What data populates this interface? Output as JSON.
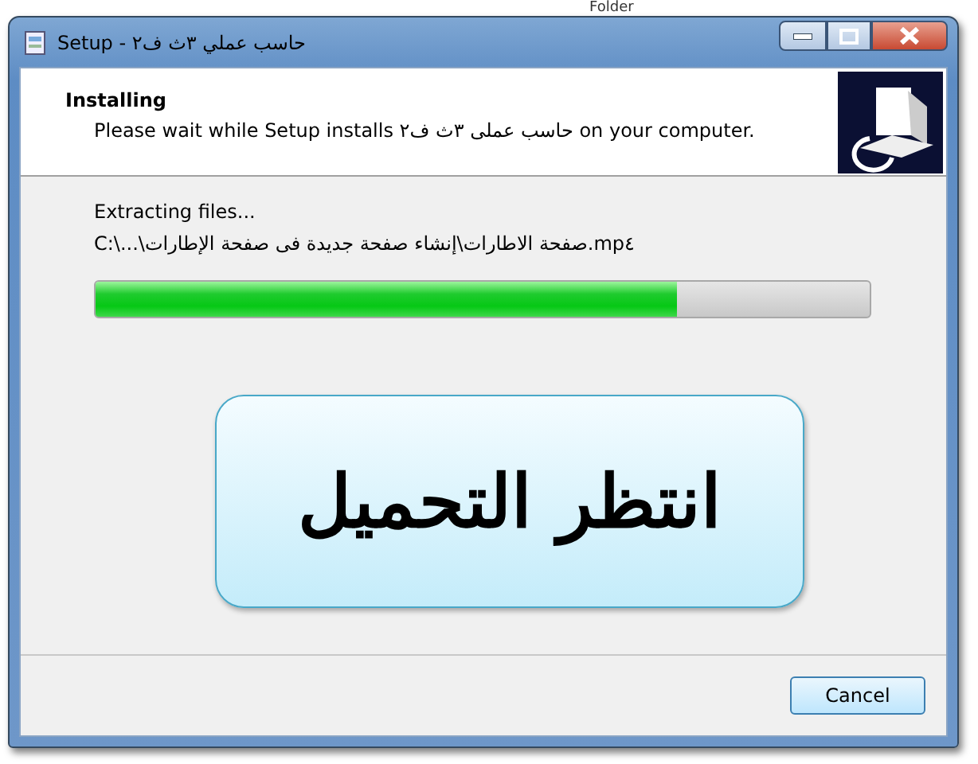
{
  "background_text": "Folder",
  "window": {
    "title": "Setup - حاسب عملي ٣ث ف٢"
  },
  "header": {
    "title": "Installing",
    "subtitle": "Please wait while Setup installs حاسب عملى ٣ث ف٢ on your computer."
  },
  "status": "Extracting files...",
  "file_path": "C:\\...\\صفحة الاطارات\\إنشاء صفحة جديدة فى صفحة الإطارات.mp٤",
  "progress": {
    "level": 0.75
  },
  "callout": "انتظر التحميل",
  "buttons": [
    "Cancel"
  ]
}
